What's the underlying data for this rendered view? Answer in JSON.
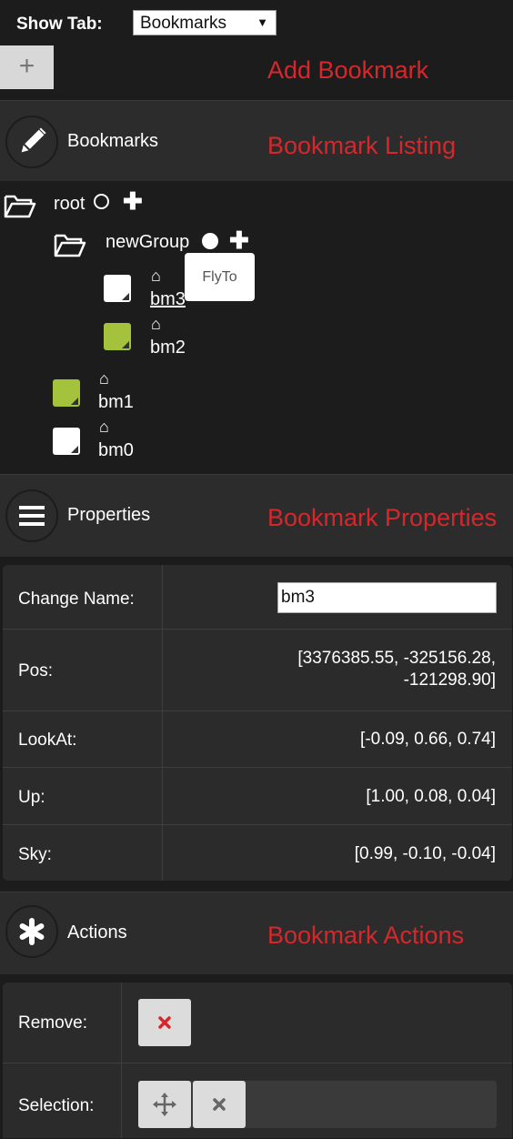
{
  "top": {
    "show_tab_label": "Show Tab:",
    "selected_tab": "Bookmarks",
    "add_button_glyph": "+",
    "add_bookmark_label": "Add Bookmark"
  },
  "bookmarks_section": {
    "title": "Bookmarks",
    "annotation": "Bookmark Listing",
    "icon": "pencil-icon"
  },
  "tree": {
    "root": "root",
    "group": "newGroup",
    "tooltip": "FlyTo",
    "items": [
      "bm3",
      "bm2",
      "bm1",
      "bm0"
    ]
  },
  "properties_section": {
    "title": "Properties",
    "annotation": "Bookmark Properties",
    "icon": "hamburger-icon"
  },
  "properties": {
    "change_name_label": "Change Name:",
    "change_name_value": "bm3",
    "pos_label": "Pos:",
    "pos_line1": "[3376385.55, -325156.28,",
    "pos_line2": "-121298.90]",
    "lookat_label": "LookAt:",
    "lookat_value": "[-0.09, 0.66, 0.74]",
    "up_label": "Up:",
    "up_value": "[1.00, 0.08, 0.04]",
    "sky_label": "Sky:",
    "sky_value": "[0.99, -0.10, -0.04]"
  },
  "actions_section": {
    "title": "Actions",
    "annotation": "Bookmark Actions",
    "icon": "asterisk-icon"
  },
  "actions": {
    "remove_label": "Remove:",
    "selection_label": "Selection:"
  },
  "colors": {
    "accent_red": "#d7272b",
    "bookmark_green": "#a4c23c",
    "background": "#1c1c1c",
    "panel": "#2c2c2c"
  }
}
